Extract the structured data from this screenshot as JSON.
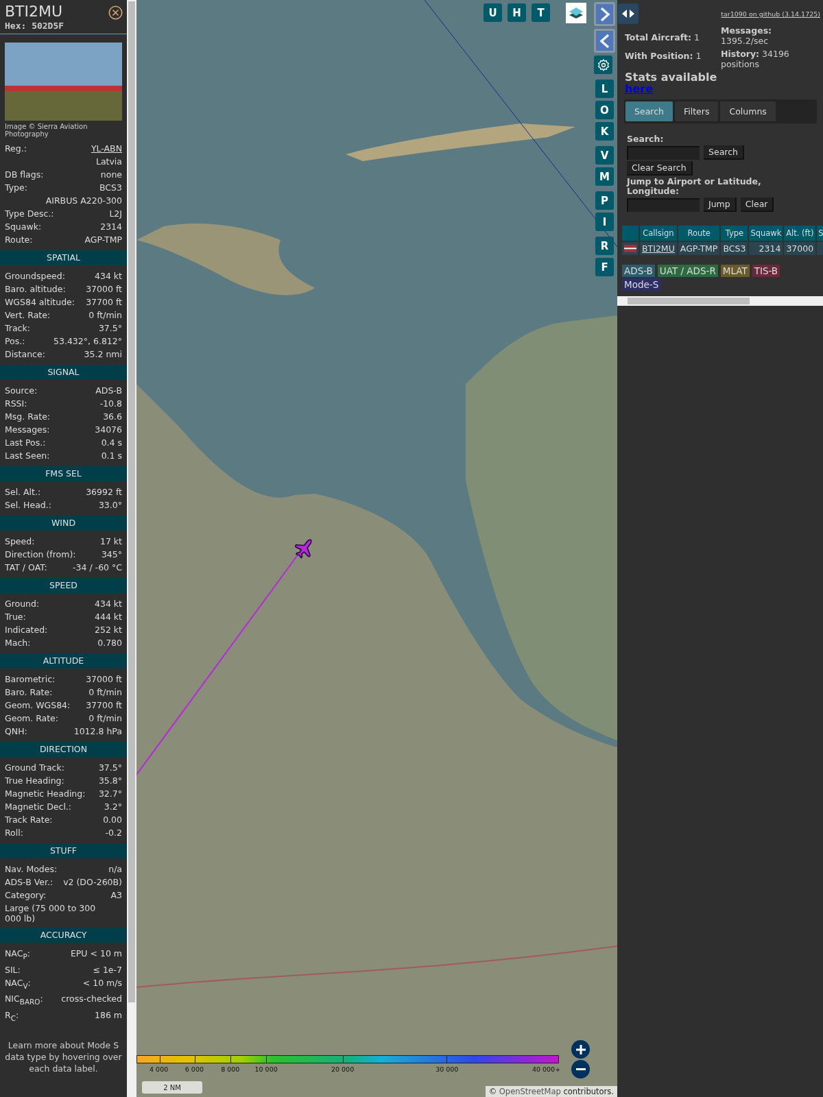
{
  "aircraft": {
    "callsign": "BTI2MU",
    "hex": "Hex: 502D5F",
    "photo_credit": "Image © Sierra Aviation Photography"
  },
  "details": [
    {
      "kind": "link",
      "label": "Reg.:",
      "value": "YL-ABN"
    },
    {
      "kind": "value",
      "value": "Latvia"
    },
    {
      "kind": "pair",
      "label": "DB flags:",
      "value": "none"
    },
    {
      "kind": "pair",
      "label": "Type:",
      "value": "BCS3"
    },
    {
      "kind": "value",
      "value": "AIRBUS A220-300"
    },
    {
      "kind": "pair",
      "label": "Type Desc.:",
      "value": "L2J"
    },
    {
      "kind": "pair",
      "label": "Squawk:",
      "value": "2314"
    },
    {
      "kind": "pair",
      "label": "Route:",
      "value": "AGP-TMP"
    }
  ],
  "sections": [
    {
      "title": "SPATIAL",
      "rows": [
        {
          "kind": "pair",
          "label": "Groundspeed:",
          "value": "434 kt"
        },
        {
          "kind": "pair",
          "label": "Baro. altitude:",
          "value": "37000 ft"
        },
        {
          "kind": "pair",
          "label": "WGS84 altitude:",
          "value": "37700 ft"
        },
        {
          "kind": "pair",
          "label": "Vert. Rate:",
          "value": "0 ft/min"
        },
        {
          "kind": "pair",
          "label": "Track:",
          "value": "37.5°"
        },
        {
          "kind": "pair",
          "label": "Pos.:",
          "value": "53.432°, 6.812°"
        },
        {
          "kind": "pair",
          "label": "Distance:",
          "value": "35.2 nmi"
        }
      ]
    },
    {
      "title": "SIGNAL",
      "rows": [
        {
          "kind": "pair",
          "label": "Source:",
          "value": "ADS-B"
        },
        {
          "kind": "pair",
          "label": "RSSI:",
          "value": "-10.8"
        },
        {
          "kind": "pair",
          "label": "Msg. Rate:",
          "value": "36.6"
        },
        {
          "kind": "pair",
          "label": "Messages:",
          "value": "34076"
        },
        {
          "kind": "pair",
          "label": "Last Pos.:",
          "value": "0.4 s"
        },
        {
          "kind": "pair",
          "label": "Last Seen:",
          "value": "0.1 s"
        }
      ]
    },
    {
      "title": "FMS SEL",
      "rows": [
        {
          "kind": "pair",
          "label": "Sel. Alt.:",
          "value": "36992 ft"
        },
        {
          "kind": "pair",
          "label": "Sel. Head.:",
          "value": "33.0°"
        }
      ]
    },
    {
      "title": "WIND",
      "rows": [
        {
          "kind": "pair",
          "label": "Speed:",
          "value": "17 kt"
        },
        {
          "kind": "pair",
          "label": "Direction (from):",
          "value": "345°"
        },
        {
          "kind": "pair",
          "label": "TAT / OAT:",
          "value": "-34 / -60 °C"
        }
      ]
    },
    {
      "title": "SPEED",
      "rows": [
        {
          "kind": "pair",
          "label": "Ground:",
          "value": "434 kt"
        },
        {
          "kind": "pair",
          "label": "True:",
          "value": "444 kt"
        },
        {
          "kind": "pair",
          "label": "Indicated:",
          "value": "252 kt"
        },
        {
          "kind": "pair",
          "label": "Mach:",
          "value": "0.780"
        }
      ]
    },
    {
      "title": "ALTITUDE",
      "rows": [
        {
          "kind": "pair",
          "label": "Barometric:",
          "value": "37000 ft"
        },
        {
          "kind": "pair",
          "label": "Baro. Rate:",
          "value": "0 ft/min"
        },
        {
          "kind": "pair",
          "label": "Geom. WGS84:",
          "value": "37700 ft"
        },
        {
          "kind": "pair",
          "label": "Geom. Rate:",
          "value": "0 ft/min"
        },
        {
          "kind": "pair",
          "label": "QNH:",
          "value": "1012.8 hPa"
        }
      ]
    },
    {
      "title": "DIRECTION",
      "rows": [
        {
          "kind": "pair",
          "label": "Ground Track:",
          "value": "37.5°"
        },
        {
          "kind": "pair",
          "label": "True Heading:",
          "value": "35.8°"
        },
        {
          "kind": "pair",
          "label": "Magnetic Heading:",
          "value": "32.7°"
        },
        {
          "kind": "pair",
          "label": "Magnetic Decl.:",
          "value": "3.2°"
        },
        {
          "kind": "pair",
          "label": "Track Rate:",
          "value": "0.00"
        },
        {
          "kind": "pair",
          "label": "Roll:",
          "value": "-0.2"
        }
      ]
    },
    {
      "title": "STUFF",
      "rows": [
        {
          "kind": "pair",
          "label": "Nav. Modes:",
          "value": "n/a"
        },
        {
          "kind": "pair",
          "label": "ADS-B Ver.:",
          "value": "v2 (DO-260B)"
        },
        {
          "kind": "pair",
          "label": "Category:",
          "value": "A3"
        },
        {
          "kind": "note",
          "value": "Large (75 000 to 300 000 lb)"
        }
      ]
    },
    {
      "title": "ACCURACY",
      "rows": [
        {
          "kind": "pair",
          "label": "NAC$_{P}$:",
          "value": "EPU < 10 m"
        },
        {
          "kind": "pair",
          "label": "SIL:",
          "value": "≤ 1e-7"
        },
        {
          "kind": "pair",
          "label": "NAC$_{V}$:",
          "value": "< 10 m/s"
        },
        {
          "kind": "pair",
          "label": "NIC$_{BARO}$:",
          "value": "cross-checked"
        },
        {
          "kind": "pair",
          "label": "R$_{C}$:",
          "value": "186 m"
        }
      ]
    }
  ],
  "footer_hint": "Learn more about Mode S data type by hovering over each data label.",
  "map": {
    "top_buttons": [
      "U",
      "H",
      "T"
    ],
    "side_groups": [
      {
        "buttons": [
          "L",
          "O",
          "K"
        ]
      },
      {
        "buttons": [
          "V",
          "M"
        ]
      },
      {
        "buttons": [
          "P",
          "I"
        ]
      },
      {
        "buttons": [
          "R",
          "F"
        ]
      }
    ],
    "altitude_legend": [
      "4 000",
      "6 000",
      "8 000",
      "10 000",
      "20 000",
      "30 000",
      "40 000+"
    ],
    "scale": "2 NM",
    "attribution": {
      "prefix": "©",
      "link": "OpenStreetMap",
      "suffix": "contributors."
    }
  },
  "panel": {
    "github_link": "tar1090 on github (3.14.1725)",
    "stats_left": [
      "**Total Aircraft:** 1",
      "**With Position:** 1"
    ],
    "stats_right": [
      "**Messages:** 1395.2/sec",
      "**History:** 34196 positions"
    ],
    "stats_note": "Stats available",
    "stats_link": "here",
    "tabs": [
      {
        "label": "Search",
        "selected": true
      },
      {
        "label": "Filters",
        "selected": false
      },
      {
        "label": "Columns",
        "selected": false
      }
    ],
    "search_label": "Search:",
    "search_button": "Search",
    "clear_search_button": "Clear Search",
    "jump_label": "Jump to Airport or Latitude, Longitude:",
    "jump_button": "Jump",
    "clear_button": "Clear",
    "table": {
      "columns": [
        "Callsign",
        "Route",
        "Type",
        "Squawk",
        "Alt. (ft)",
        "S"
      ],
      "rows": [
        {
          "callsign": "BTI2MU",
          "route": "AGP-TMP",
          "type": "BCS3",
          "squawk": "2314",
          "altitude": "37000"
        }
      ]
    },
    "sources": [
      {
        "label": "ADS-B",
        "color": "#2d5b6a"
      },
      {
        "label": "UAT / ADS-R",
        "color": "#2e6a3f"
      },
      {
        "label": "MLAT",
        "color": "#6a5b2d"
      },
      {
        "label": "TIS-B",
        "color": "#6a2a3c"
      },
      {
        "label": "Mode-S",
        "color": "#2d2d6a"
      }
    ]
  }
}
